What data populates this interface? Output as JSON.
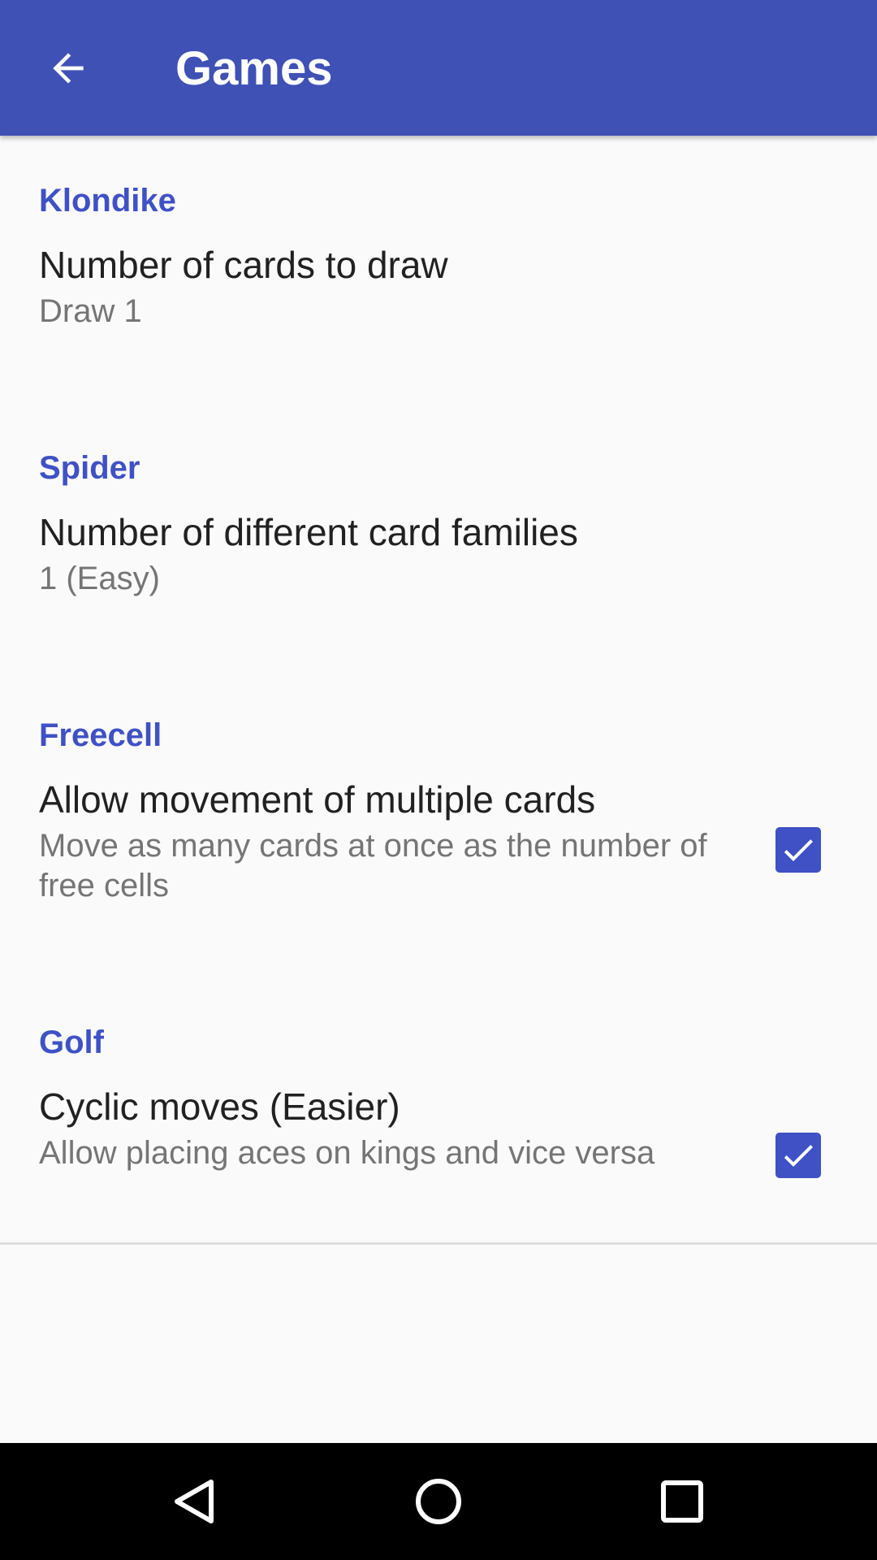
{
  "toolbar": {
    "title": "Games",
    "back_icon": "arrow-back-icon",
    "color": "#3F51B5"
  },
  "sections": [
    {
      "category": "Klondike",
      "pref_title": "Number of cards to draw",
      "pref_summary": "Draw 1"
    },
    {
      "category": "Spider",
      "pref_title": "Number of different card families",
      "pref_summary": "1 (Easy)"
    },
    {
      "category": "Freecell",
      "pref_title": "Allow movement of multiple cards",
      "pref_summary": "Move as many cards at once as the number of free cells",
      "checked": true
    },
    {
      "category": "Golf",
      "pref_title": "Cyclic moves (Easier)",
      "pref_summary": "Allow placing aces on kings and vice versa",
      "checked": true
    }
  ],
  "navbar": {
    "back_icon": "nav-back-triangle-icon",
    "home_icon": "nav-home-circle-icon",
    "recents_icon": "nav-recents-square-icon"
  },
  "colors": {
    "accent": "#3F51C5",
    "primary_text": "#212121",
    "secondary_text": "#757575",
    "background": "#FAFAFA"
  }
}
